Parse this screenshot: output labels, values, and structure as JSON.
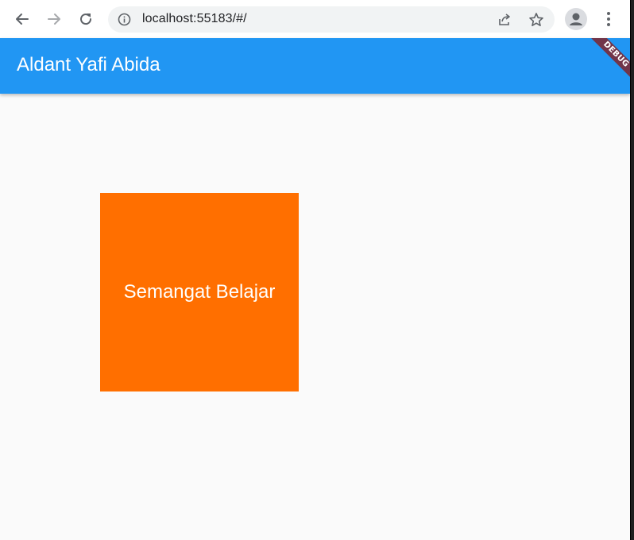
{
  "browser": {
    "url": "localhost:55183/#/",
    "icons": {
      "back": "back-arrow-icon",
      "forward": "forward-arrow-icon",
      "reload": "reload-icon",
      "site_info": "info-icon",
      "share": "share-icon",
      "bookmark": "star-icon",
      "profile": "profile-icon",
      "menu": "kebab-menu-icon"
    }
  },
  "app": {
    "title": "Aldant Yafi Abida",
    "debug_label": "DEBUG",
    "box_text": "Semangat Belajar"
  },
  "colors": {
    "appbar": "#2196f3",
    "box": "#ff6f00",
    "background": "#fafafa",
    "debug_ribbon": "#71354a"
  }
}
